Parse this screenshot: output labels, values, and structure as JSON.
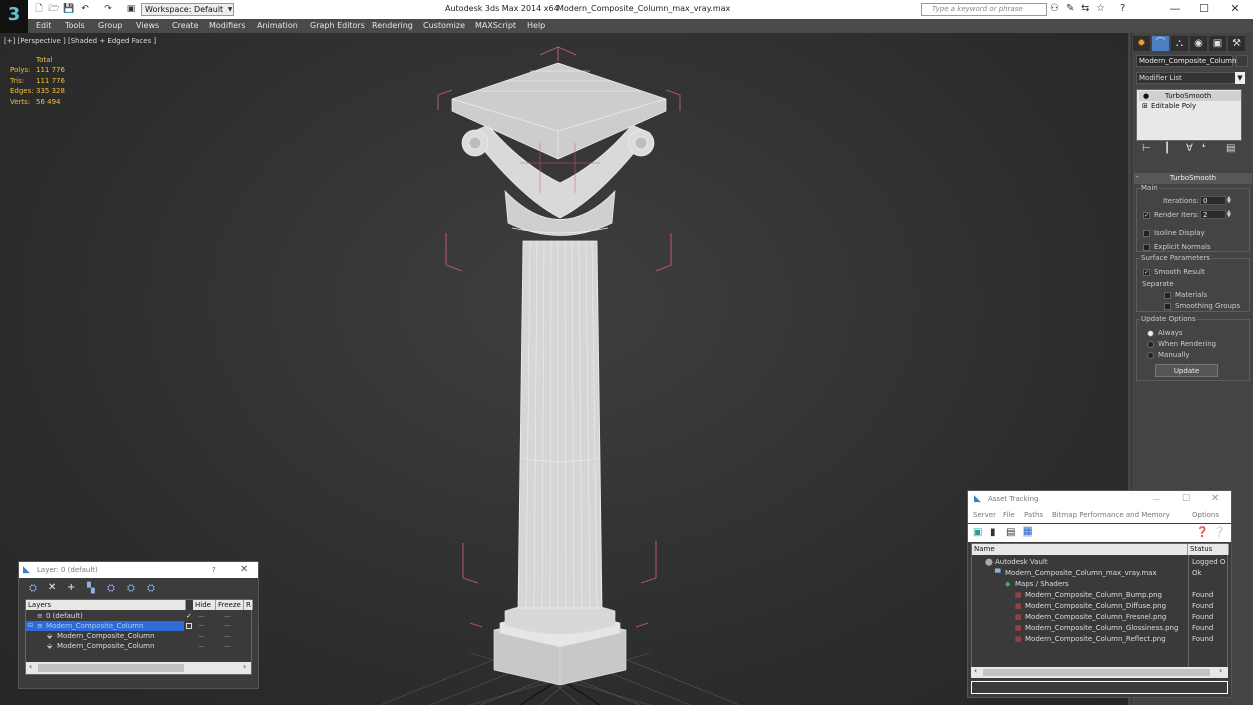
{
  "titlebar": {
    "workspace": "Workspace: Default",
    "app_title": "Autodesk 3ds Max  2014 x64",
    "file_title": "Modern_Composite_Column_max_vray.max",
    "search_placeholder": "Type a keyword or phrase"
  },
  "menu": [
    "Edit",
    "Tools",
    "Group",
    "Views",
    "Create",
    "Modifiers",
    "Animation",
    "Graph Editors",
    "Rendering",
    "Customize",
    "MAXScript",
    "Help"
  ],
  "viewport": {
    "label": "[+] [Perspective ] [Shaded + Edged Faces ]",
    "stats_header": "Total",
    "stats": [
      {
        "label": "Polys:",
        "value": "111 776"
      },
      {
        "label": "Tris:",
        "value": "111 776"
      },
      {
        "label": "Edges:",
        "value": "335 328"
      },
      {
        "label": "Verts:",
        "value": "56 494"
      }
    ]
  },
  "command_panel": {
    "object_name": "Modern_Composite_Column",
    "modifier_list": "Modifier List",
    "stack": [
      "TurboSmooth",
      "Editable Poly"
    ],
    "rollout_title": "TurboSmooth",
    "main_label": "Main",
    "iterations_label": "Iterations:",
    "iterations_value": "0",
    "render_iters_label": "Render Iters:",
    "render_iters_value": "2",
    "isoline": "Isoline Display",
    "explicit_normals": "Explicit Normals",
    "surface_params": "Surface Parameters",
    "smooth_result": "Smooth Result",
    "separate": "Separate",
    "materials": "Materials",
    "smoothing_groups": "Smoothing Groups",
    "update_options": "Update Options",
    "always": "Always",
    "when_rendering": "When Rendering",
    "manually": "Manually",
    "update_button": "Update"
  },
  "layer_dialog": {
    "title": "Layer: 0 (default)",
    "help": "?",
    "columns": [
      "Layers",
      "Hide",
      "Freeze",
      "R"
    ],
    "rows": [
      "0 (default)",
      "Modern_Composite_Column",
      "Modern_Composite_Column",
      "Modern_Composite_Column"
    ]
  },
  "asset_dialog": {
    "title": "Asset Tracking",
    "menu": [
      "Server",
      "File",
      "Paths",
      "Bitmap Performance and Memory",
      "Options"
    ],
    "columns": [
      "Name",
      "Status"
    ],
    "rows": [
      {
        "name": "Autodesk Vault",
        "status": "Logged O"
      },
      {
        "name": "Modern_Composite_Column_max_vray.max",
        "status": "Ok"
      },
      {
        "name": "Maps / Shaders",
        "status": ""
      },
      {
        "name": "Modern_Composite_Column_Bump.png",
        "status": "Found"
      },
      {
        "name": "Modern_Composite_Column_Diffuse.png",
        "status": "Found"
      },
      {
        "name": "Modern_Composite_Column_Fresnel.png",
        "status": "Found"
      },
      {
        "name": "Modern_Composite_Column_Glossiness.png",
        "status": "Found"
      },
      {
        "name": "Modern_Composite_Column_Reflect.png",
        "status": "Found"
      }
    ]
  },
  "colors": {
    "stats": "#f0c040",
    "selection": "#2f6bd6",
    "bounding_box": "#d05a78"
  }
}
